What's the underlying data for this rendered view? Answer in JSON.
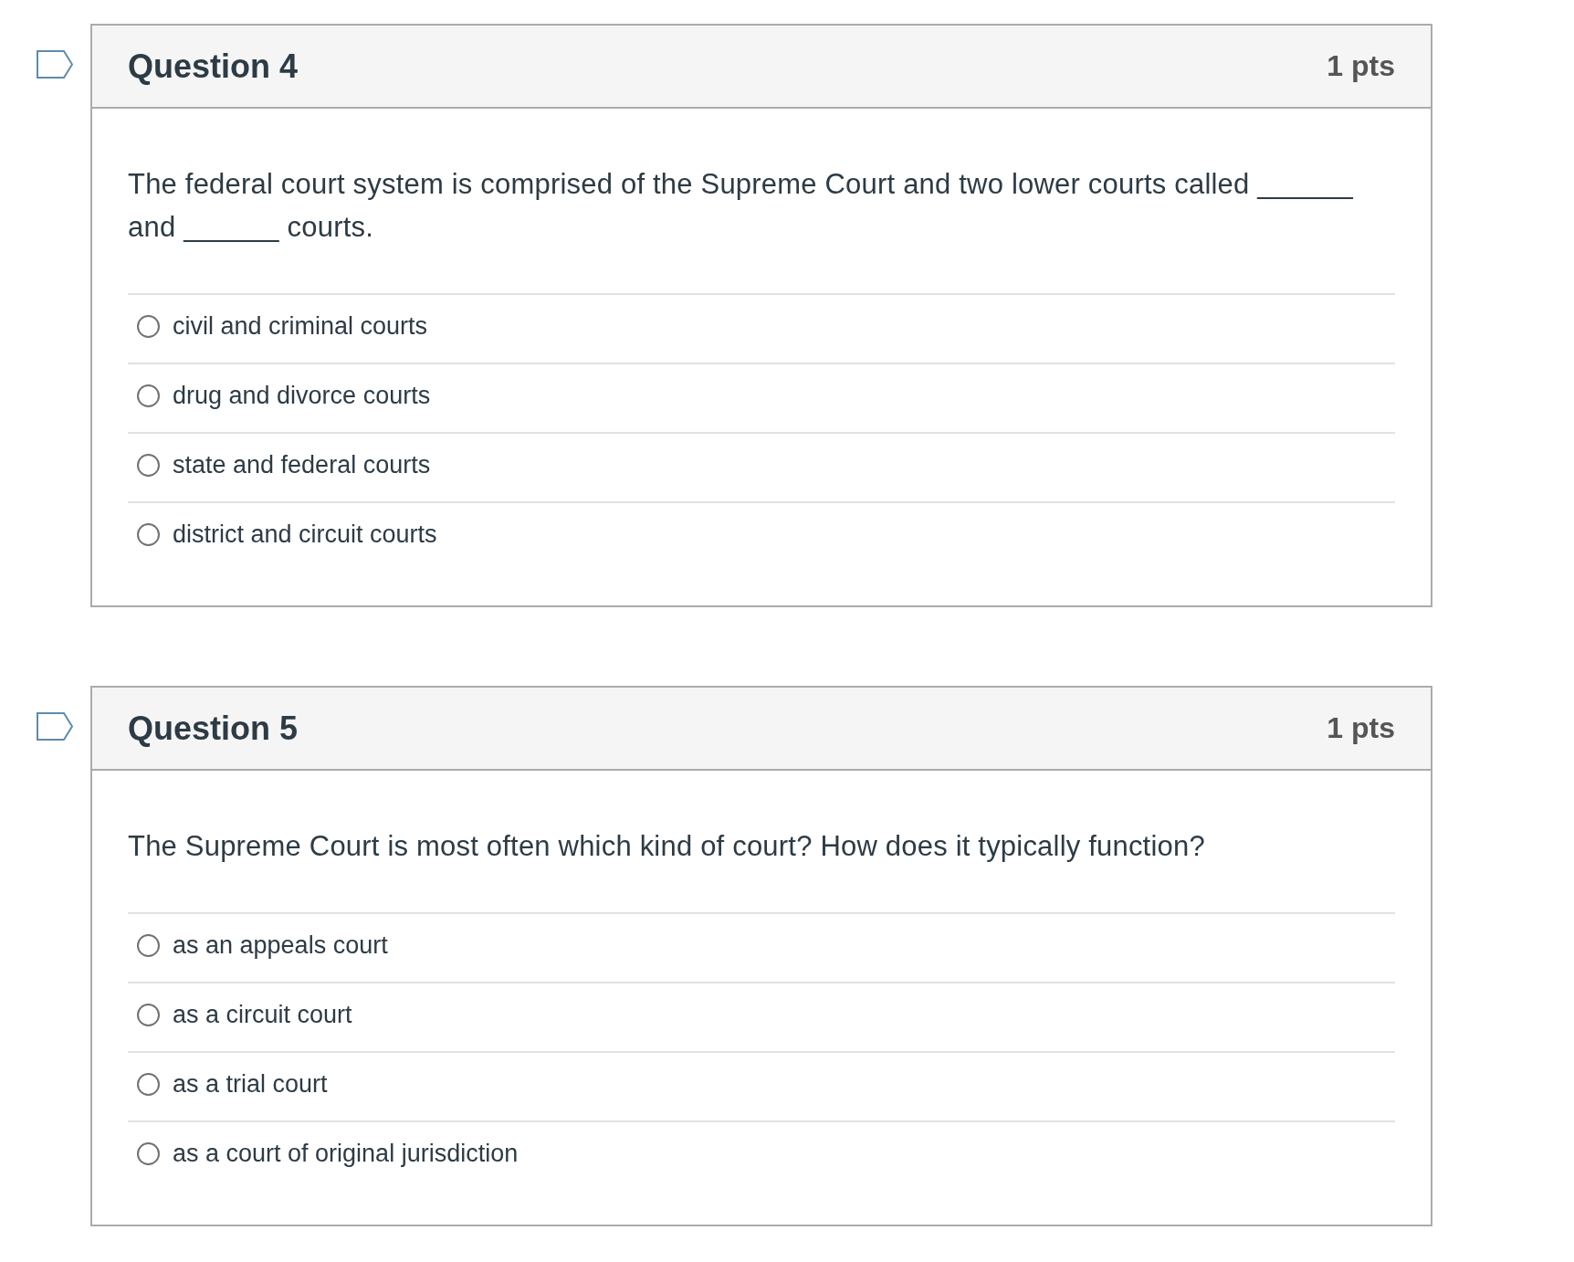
{
  "questions": [
    {
      "title": "Question 4",
      "points": "1 pts",
      "flagged": false,
      "text": "The federal court system is comprised of the Supreme Court and two lower courts called ______ and ______ courts.",
      "answers": [
        {
          "label": "civil and criminal courts",
          "selected": false
        },
        {
          "label": "drug and divorce courts",
          "selected": false
        },
        {
          "label": "state and federal courts",
          "selected": false
        },
        {
          "label": "district and circuit courts",
          "selected": false
        }
      ]
    },
    {
      "title": "Question 5",
      "points": "1 pts",
      "flagged": false,
      "text": "The Supreme Court is most often which kind of court? How does it typically function?",
      "answers": [
        {
          "label": "as an appeals court",
          "selected": false
        },
        {
          "label": "as a circuit court",
          "selected": false
        },
        {
          "label": "as a trial court",
          "selected": false
        },
        {
          "label": "as a court of original jurisdiction",
          "selected": false
        }
      ]
    }
  ]
}
